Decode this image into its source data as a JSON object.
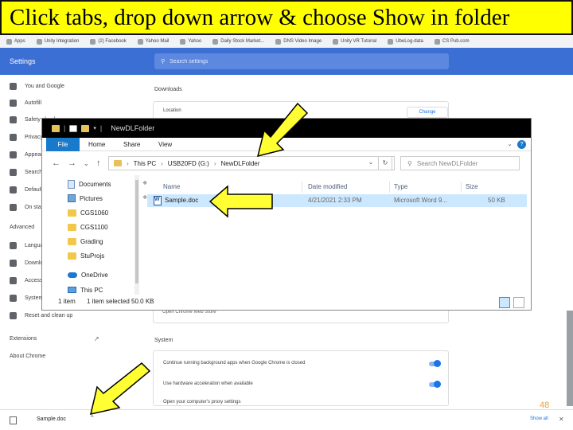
{
  "banner": {
    "text": "Click tabs, drop down arrow & choose Show in folder"
  },
  "bookmarks": [
    "Apps",
    "Unity Integration",
    "(2) Facebook",
    "Yahoo Mail",
    "Yahoo",
    "Daily Stock Market...",
    "DNS Video Image",
    "Unity VR Tutorial",
    "UbeLog-data",
    "CS Pub.com"
  ],
  "settings": {
    "title": "Settings",
    "search_placeholder": "Search settings"
  },
  "sidebar": {
    "items": [
      "You and Google",
      "Autofill",
      "Safety check",
      "Privacy and security",
      "Appearance",
      "Search engine",
      "Default browser",
      "On startup"
    ],
    "advanced_label": "Advanced",
    "advanced_items": [
      "Languages",
      "Downloads",
      "Accessibility",
      "System",
      "Reset and clean up"
    ],
    "extensions_label": "Extensions",
    "about_label": "About Chrome"
  },
  "main": {
    "downloads_section": "Downloads",
    "location_label": "Location",
    "change_label": "Change",
    "open_store_text": "Open Chrome Web Store",
    "system_section": "System",
    "system_rows": [
      "Continue running background apps when Google Chrome is closed",
      "Use hardware acceleration when available",
      "Open your computer's proxy settings"
    ]
  },
  "explorer": {
    "title": "NewDLFolder",
    "ribbon": {
      "file": "File",
      "home": "Home",
      "share": "Share",
      "view": "View"
    },
    "address_path": [
      "This PC",
      "USB20FD (G:)",
      "NewDLFolder"
    ],
    "search_placeholder": "Search NewDLFolder",
    "nav_items": [
      "Documents",
      "Pictures",
      "CGS1060",
      "CGS1100",
      "Grading",
      "StuProjs",
      "OneDrive",
      "This PC"
    ],
    "columns": [
      "Name",
      "Date modified",
      "Type",
      "Size"
    ],
    "file": {
      "name": "Sample.doc",
      "date": "4/21/2021 2:33 PM",
      "type": "Microsoft Word 9...",
      "size": "50 KB"
    },
    "status": {
      "count": "1 item",
      "selected": "1 item selected  50.0 KB"
    }
  },
  "download_bar": {
    "file": "Sample.doc",
    "show_all": "Show all"
  },
  "slide_number": "48",
  "colors": {
    "banner": "#ffff00",
    "chrome_header": "#3b6fd4",
    "arrow_fill": "#ffff33",
    "selection": "#cce8ff"
  }
}
